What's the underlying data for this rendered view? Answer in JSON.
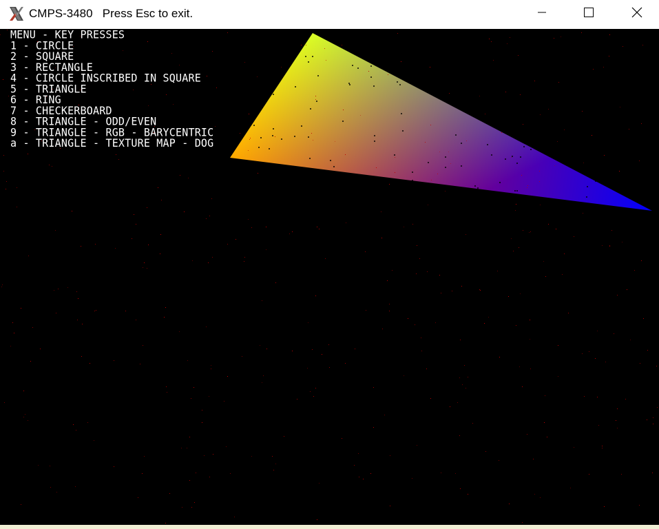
{
  "window": {
    "title": "CMPS-3480   Press Esc to exit.",
    "app_icon": "x-logo-icon",
    "controls": {
      "minimize_icon": "minimize-icon",
      "maximize_icon": "maximize-icon",
      "close_icon": "close-icon"
    }
  },
  "menu": {
    "header": "MENU - KEY PRESSES",
    "items": [
      "1 - CIRCLE",
      "2 - SQUARE",
      "3 - RECTANGLE",
      "4 - CIRCLE INSCRIBED IN SQUARE",
      "5 - TRIANGLE",
      "6 - RING",
      "7 - CHECKERBOARD",
      "8 - TRIANGLE - ODD/EVEN",
      "9 - TRIANGLE - RGB - BARYCENTRIC",
      "a - TRIANGLE - TEXTURE MAP - DOG"
    ]
  },
  "scene": {
    "shape": "triangle",
    "fill": "rgb-barycentric",
    "vertex_colors": [
      "#ff0000",
      "#00ff00",
      "#0000ff"
    ],
    "background_color": "#000000",
    "noise_color": "#c00000"
  }
}
